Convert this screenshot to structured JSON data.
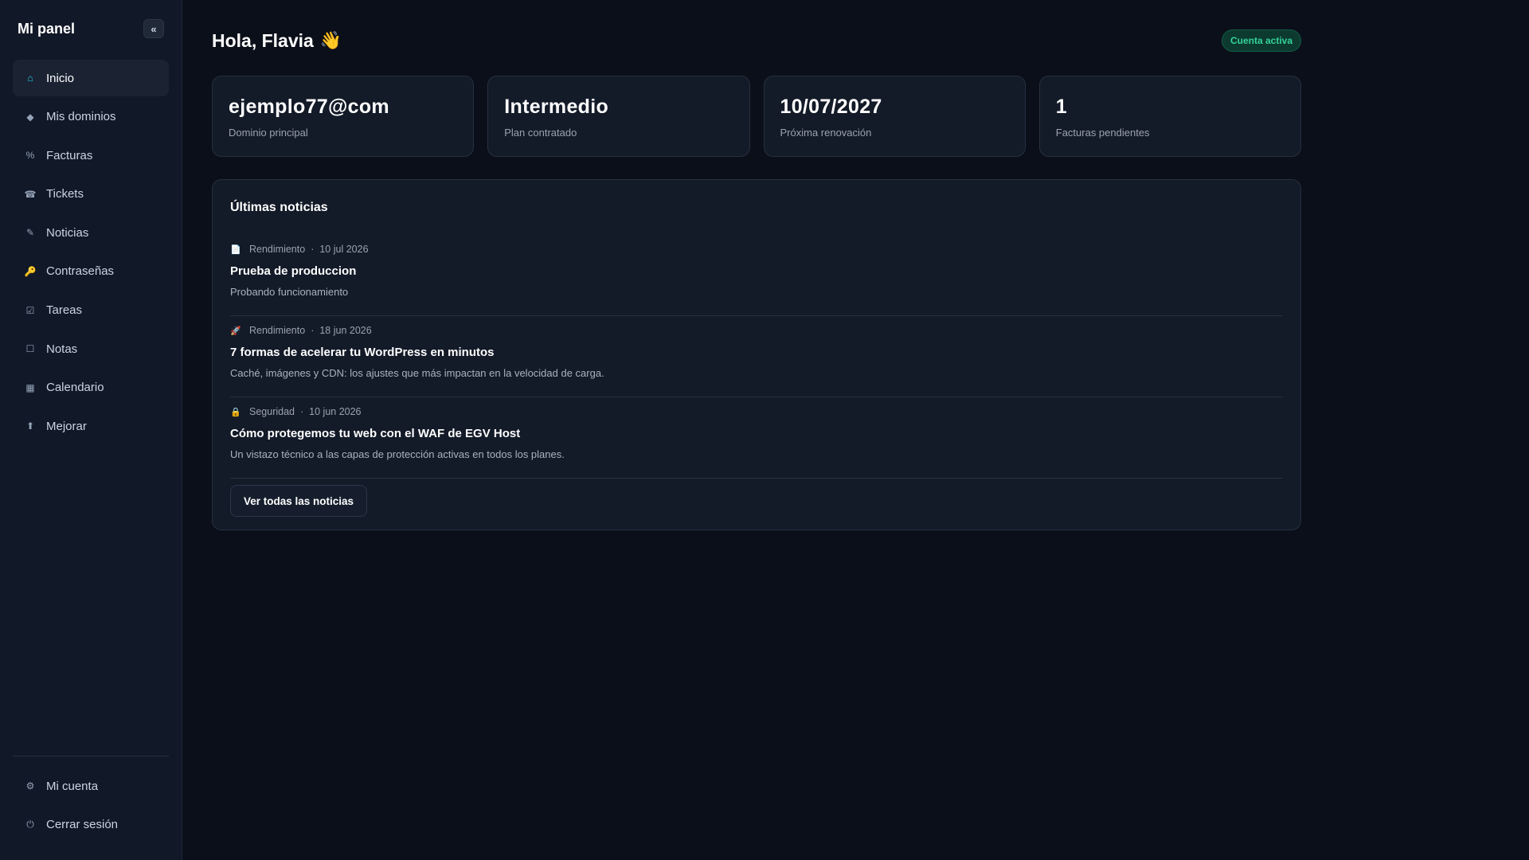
{
  "sidebar": {
    "title": "Mi panel",
    "collapse_label": "«",
    "items": [
      {
        "label": "Inicio",
        "icon": "⌂",
        "active": true
      },
      {
        "label": "Mis dominios",
        "icon": "◆"
      },
      {
        "label": "Facturas",
        "icon": "%"
      },
      {
        "label": "Tickets",
        "icon": "☎"
      },
      {
        "label": "Noticias",
        "icon": "✎"
      },
      {
        "label": "Contraseñas",
        "icon": "🔑"
      },
      {
        "label": "Tareas",
        "icon": "☑"
      },
      {
        "label": "Notas",
        "icon": "☐"
      },
      {
        "label": "Calendario",
        "icon": "▦"
      },
      {
        "label": "Mejorar",
        "icon": "⬆"
      }
    ],
    "bottom_items": [
      {
        "label": "Mi cuenta",
        "icon": "⚙"
      },
      {
        "label": "Cerrar sesión",
        "icon": "⏻"
      }
    ]
  },
  "header": {
    "greeting": "Hola, Flavia",
    "wave": "👋",
    "status_badge": "Cuenta activa"
  },
  "stats": [
    {
      "value": "ejemplo77@com",
      "label": "Dominio principal"
    },
    {
      "value": "Intermedio",
      "label": "Plan contratado"
    },
    {
      "value": "10/07/2027",
      "label": "Próxima renovación"
    },
    {
      "value": "1",
      "label": "Facturas pendientes"
    }
  ],
  "news": {
    "title": "Últimas noticias",
    "items": [
      {
        "icon": "📄",
        "category": "Rendimiento",
        "sep": "·",
        "date": "10 jul 2026",
        "headline": "Prueba de produccion",
        "desc": "Probando funcionamiento"
      },
      {
        "icon": "🚀",
        "category": "Rendimiento",
        "sep": "·",
        "date": "18 jun 2026",
        "headline": "7 formas de acelerar tu WordPress en minutos",
        "desc": "Caché, imágenes y CDN: los ajustes que más impactan en la velocidad de carga."
      },
      {
        "icon": "🔒",
        "category": "Seguridad",
        "sep": "·",
        "date": "10 jun 2026",
        "headline": "Cómo protegemos tu web con el WAF de EGV Host",
        "desc": "Un vistazo técnico a las capas de protección activas en todos los planes."
      }
    ],
    "all_button": "Ver todas las noticias"
  },
  "colors": {
    "background": "#0b0f19",
    "sidebar": "#111827",
    "card": "#131a28",
    "accent_active": "#22d3ee",
    "badge_text": "#34d399"
  }
}
